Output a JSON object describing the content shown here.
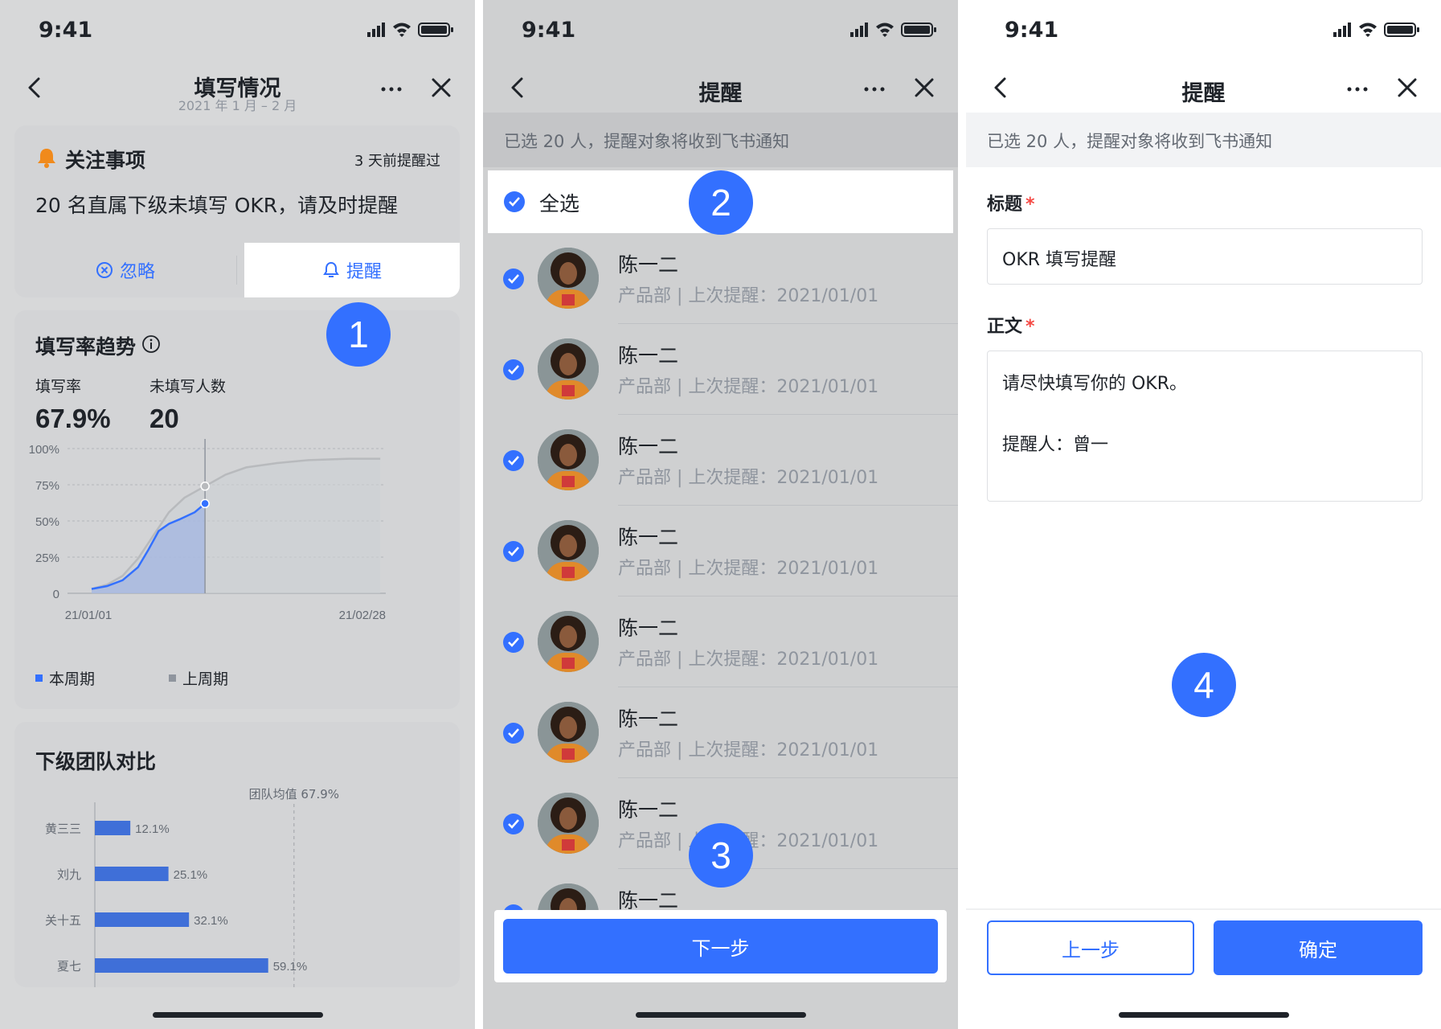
{
  "status": {
    "time": "9:41"
  },
  "screen1": {
    "nav": {
      "title": "填写情况",
      "subtitle": "2021 年 1 月 – 2 月"
    },
    "notice": {
      "title": "关注事项",
      "time_hint": "3 天前提醒过",
      "message": "20 名直属下级未填写 OKR，请及时提醒",
      "ignore_label": "忽略",
      "remind_label": "提醒"
    },
    "trend": {
      "title": "填写率趋势",
      "rate_label": "填写率",
      "rate_value": "67.9%",
      "unfilled_label": "未填写人数",
      "unfilled_value": "20",
      "legend_current": "本周期",
      "legend_previous": "上周期"
    },
    "team": {
      "title": "下级团队对比",
      "avg_label": "团队均值 67.9%"
    },
    "badge": "1"
  },
  "screen2": {
    "nav": {
      "title": "提醒"
    },
    "info": "已选 20 人，提醒对象将收到飞书通知",
    "select_all": "全选",
    "people": [
      {
        "name": "陈一二",
        "meta": "产品部 | 上次提醒：2021/01/01"
      },
      {
        "name": "陈一二",
        "meta": "产品部 | 上次提醒：2021/01/01"
      },
      {
        "name": "陈一二",
        "meta": "产品部 | 上次提醒：2021/01/01"
      },
      {
        "name": "陈一二",
        "meta": "产品部 | 上次提醒：2021/01/01"
      },
      {
        "name": "陈一二",
        "meta": "产品部 | 上次提醒：2021/01/01"
      },
      {
        "name": "陈一二",
        "meta": "产品部 | 上次提醒：2021/01/01"
      },
      {
        "name": "陈一二",
        "meta": "产品部 | 上次提醒：2021/01/01"
      },
      {
        "name": "陈一二",
        "meta": ""
      }
    ],
    "next_label": "下一步",
    "badge_select": "2",
    "badge_next": "3"
  },
  "screen3": {
    "nav": {
      "title": "提醒"
    },
    "info": "已选 20 人，提醒对象将收到飞书通知",
    "title_label": "标题",
    "title_value": "OKR 填写提醒",
    "body_label": "正文",
    "body_line1": "请尽快填写你的 OKR。",
    "body_line2": "提醒人：曾一",
    "required_mark": "*",
    "prev_label": "上一步",
    "confirm_label": "确定",
    "badge": "4"
  },
  "chart_data": [
    {
      "type": "line",
      "title": "填写率趋势",
      "x_tick_labels": [
        "21/01/01",
        "21/02/28"
      ],
      "y_tick_labels": [
        "0",
        "25%",
        "50%",
        "75%",
        "100%"
      ],
      "ylim": [
        0,
        100
      ],
      "x_domain_days": [
        0,
        58
      ],
      "grid": true,
      "legend": "bottom",
      "series": [
        {
          "name": "本周期",
          "color": "#3370ff",
          "x": [
            0,
            3,
            6,
            9,
            11,
            13,
            15,
            17,
            20,
            22
          ],
          "y": [
            3,
            5,
            9,
            18,
            30,
            43,
            48,
            51,
            56,
            62
          ]
        },
        {
          "name": "上周期",
          "color": "#b8babd",
          "x": [
            0,
            3,
            6,
            9,
            12,
            15,
            18,
            22,
            26,
            30,
            36,
            42,
            50,
            56
          ],
          "y": [
            3,
            6,
            12,
            24,
            40,
            56,
            66,
            74,
            82,
            87,
            90,
            92,
            93,
            93
          ]
        }
      ],
      "marker_x": 22
    },
    {
      "type": "bar",
      "title": "下级团队对比",
      "categories": [
        "黄三三",
        "刘九",
        "关十五",
        "夏七"
      ],
      "values": [
        12.1,
        25.1,
        32.1,
        59.1
      ],
      "value_labels": [
        "12.1%",
        "25.1%",
        "32.1%",
        "59.1%"
      ],
      "xlim": [
        0,
        100
      ],
      "reference_value": 67.9,
      "reference_label": "团队均值 67.9%",
      "color": "#3f6fd8"
    }
  ]
}
